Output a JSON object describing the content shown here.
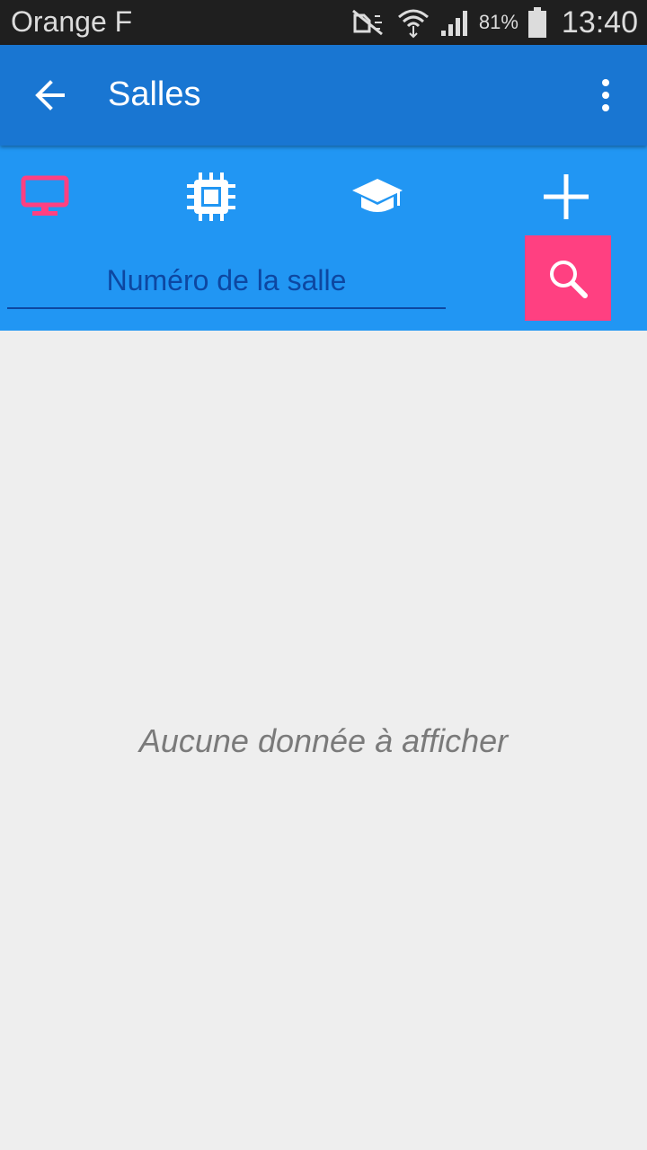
{
  "status_bar": {
    "carrier": "Orange F",
    "battery": "81%",
    "time": "13:40",
    "icons": [
      "mute-icon",
      "wifi-icon",
      "signal-icon",
      "battery-icon"
    ]
  },
  "app_bar": {
    "title": "Salles",
    "back_icon": "arrow-back-icon",
    "menu_icon": "overflow-menu-icon"
  },
  "tabs": [
    {
      "icon": "monitor-icon",
      "active": true,
      "color": "#ff4081"
    },
    {
      "icon": "chip-icon",
      "active": false,
      "color": "#ffffff"
    },
    {
      "icon": "graduation-cap-icon",
      "active": false,
      "color": "#ffffff"
    },
    {
      "icon": "plus-icon",
      "active": false,
      "color": "#ffffff"
    }
  ],
  "search": {
    "placeholder": "Numéro de la salle",
    "button_icon": "search-icon"
  },
  "content": {
    "empty_message": "Aucune donnée à afficher"
  },
  "colors": {
    "primary_dark": "#1976d2",
    "primary": "#2196f3",
    "accent": "#ff4081",
    "background": "#eeeeee"
  }
}
